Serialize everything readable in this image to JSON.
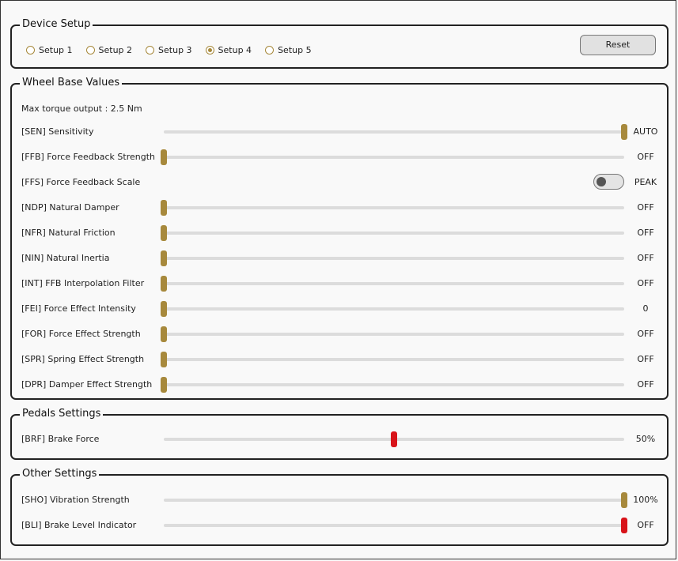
{
  "colors": {
    "accent": "#a7893c",
    "danger": "#d8141a",
    "track": "#dcdcdc"
  },
  "device_setup": {
    "title": "Device Setup",
    "setups": [
      {
        "label": "Setup 1",
        "checked": false
      },
      {
        "label": "Setup 2",
        "checked": false
      },
      {
        "label": "Setup 3",
        "checked": false
      },
      {
        "label": "Setup 4",
        "checked": true
      },
      {
        "label": "Setup 5",
        "checked": false
      }
    ],
    "reset_label": "Reset"
  },
  "wheel_base": {
    "title": "Wheel Base Values",
    "max_torque": "Max torque output :  2.5 Nm",
    "rows": [
      {
        "kind": "slider",
        "label": "[SEN] Sensitivity",
        "value": "AUTO",
        "level": 1.0,
        "color": "#a7893c"
      },
      {
        "kind": "slider",
        "label": "[FFB] Force Feedback Strength",
        "value": "OFF",
        "level": 0.0,
        "color": "#a7893c"
      },
      {
        "kind": "toggle",
        "label": "[FFS] Force Feedback Scale",
        "value": "PEAK",
        "on": false
      },
      {
        "kind": "slider",
        "label": "[NDP] Natural Damper",
        "value": "OFF",
        "level": 0.0,
        "color": "#a7893c"
      },
      {
        "kind": "slider",
        "label": "[NFR] Natural Friction",
        "value": "OFF",
        "level": 0.0,
        "color": "#a7893c"
      },
      {
        "kind": "slider",
        "label": "[NIN] Natural Inertia",
        "value": "OFF",
        "level": 0.0,
        "color": "#a7893c"
      },
      {
        "kind": "slider",
        "label": "[INT] FFB Interpolation Filter",
        "value": "OFF",
        "level": 0.0,
        "color": "#a7893c"
      },
      {
        "kind": "slider",
        "label": "[FEI] Force Effect Intensity",
        "value": "0",
        "level": 0.0,
        "color": "#a7893c"
      },
      {
        "kind": "slider",
        "label": "[FOR] Force Effect Strength",
        "value": "OFF",
        "level": 0.0,
        "color": "#a7893c"
      },
      {
        "kind": "slider",
        "label": "[SPR] Spring Effect Strength",
        "value": "OFF",
        "level": 0.0,
        "color": "#a7893c"
      },
      {
        "kind": "slider",
        "label": "[DPR] Damper Effect Strength",
        "value": "OFF",
        "level": 0.0,
        "color": "#a7893c"
      }
    ]
  },
  "pedals": {
    "title": "Pedals Settings",
    "rows": [
      {
        "kind": "slider",
        "label": "[BRF] Brake Force",
        "value": "50%",
        "level": 0.5,
        "color": "#d8141a"
      }
    ]
  },
  "other": {
    "title": "Other Settings",
    "rows": [
      {
        "kind": "slider",
        "label": "[SHO] Vibration Strength",
        "value": "100%",
        "level": 1.0,
        "color": "#a7893c"
      },
      {
        "kind": "slider",
        "label": "[BLI] Brake Level Indicator",
        "value": "OFF",
        "level": 1.0,
        "color": "#d8141a"
      }
    ]
  }
}
